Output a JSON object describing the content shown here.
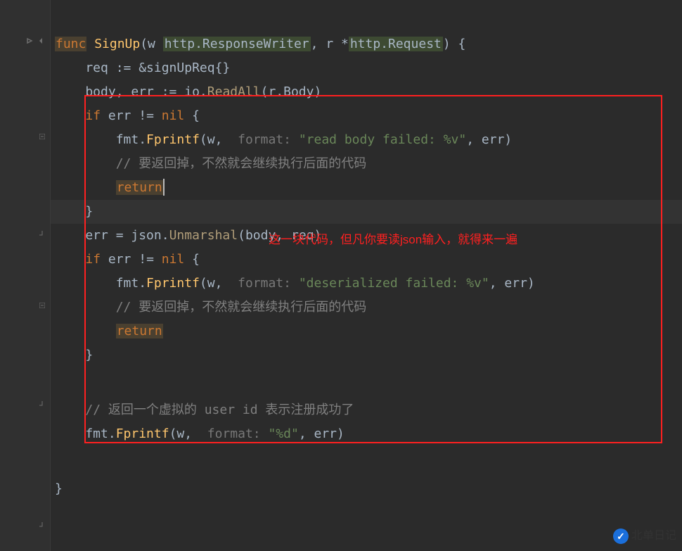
{
  "code": {
    "l1_func": "func",
    "l1_name": " SignUp",
    "l1_params_open": "(w ",
    "l1_type1": "http.ResponseWriter",
    "l1_comma": ", r *",
    "l1_type2": "http.Request",
    "l1_close": ") {",
    "l2": "    req := &signUpReq{}",
    "l3_a": "    body, err := ",
    "l3_b": "io",
    "l3_c": ".",
    "l3_d": "ReadAll",
    "l3_e": "(r.Body)",
    "l4_a": "    ",
    "l4_if": "if",
    "l4_b": " err != ",
    "l4_nil": "nil",
    "l4_c": " {",
    "l5_a": "        fmt.",
    "l5_b": "Fprintf",
    "l5_c": "(w, ",
    "l5_hint": " format: ",
    "l5_str": "\"read body failed: %v\"",
    "l5_d": ", err)",
    "l6_a": "        ",
    "l6_comment": "// 要返回掉，不然就会继续执行后面的代码",
    "l7_a": "        ",
    "l7_return": "return",
    "l8": "    }",
    "l9_a": "    err = ",
    "l9_b": "json",
    "l9_c": ".",
    "l9_d": "Unmarshal",
    "l9_e": "(body, req)",
    "l10_a": "    ",
    "l10_if": "if",
    "l10_b": " err != ",
    "l10_nil": "nil",
    "l10_c": " {",
    "l11_a": "        fmt.",
    "l11_b": "Fprintf",
    "l11_c": "(w, ",
    "l11_hint": " format: ",
    "l11_str": "\"deserialized failed: %v\"",
    "l11_d": ", err)",
    "l12_a": "        ",
    "l12_comment": "// 要返回掉，不然就会继续执行后面的代码",
    "l13_a": "        ",
    "l13_return": "return",
    "l14": "    }",
    "l15_a": "    ",
    "l15_comment": "// 返回一个虚拟的 user id 表示注册成功了",
    "l16_a": "    fmt.",
    "l16_b": "Fprintf",
    "l16_c": "(w, ",
    "l16_hint": " format: ",
    "l16_str": "\"%d\"",
    "l16_d": ", err)",
    "l17": "}"
  },
  "annotation": "这一块代码，但凡你要读json输入，就得来一遍",
  "watermark": "北单日记"
}
